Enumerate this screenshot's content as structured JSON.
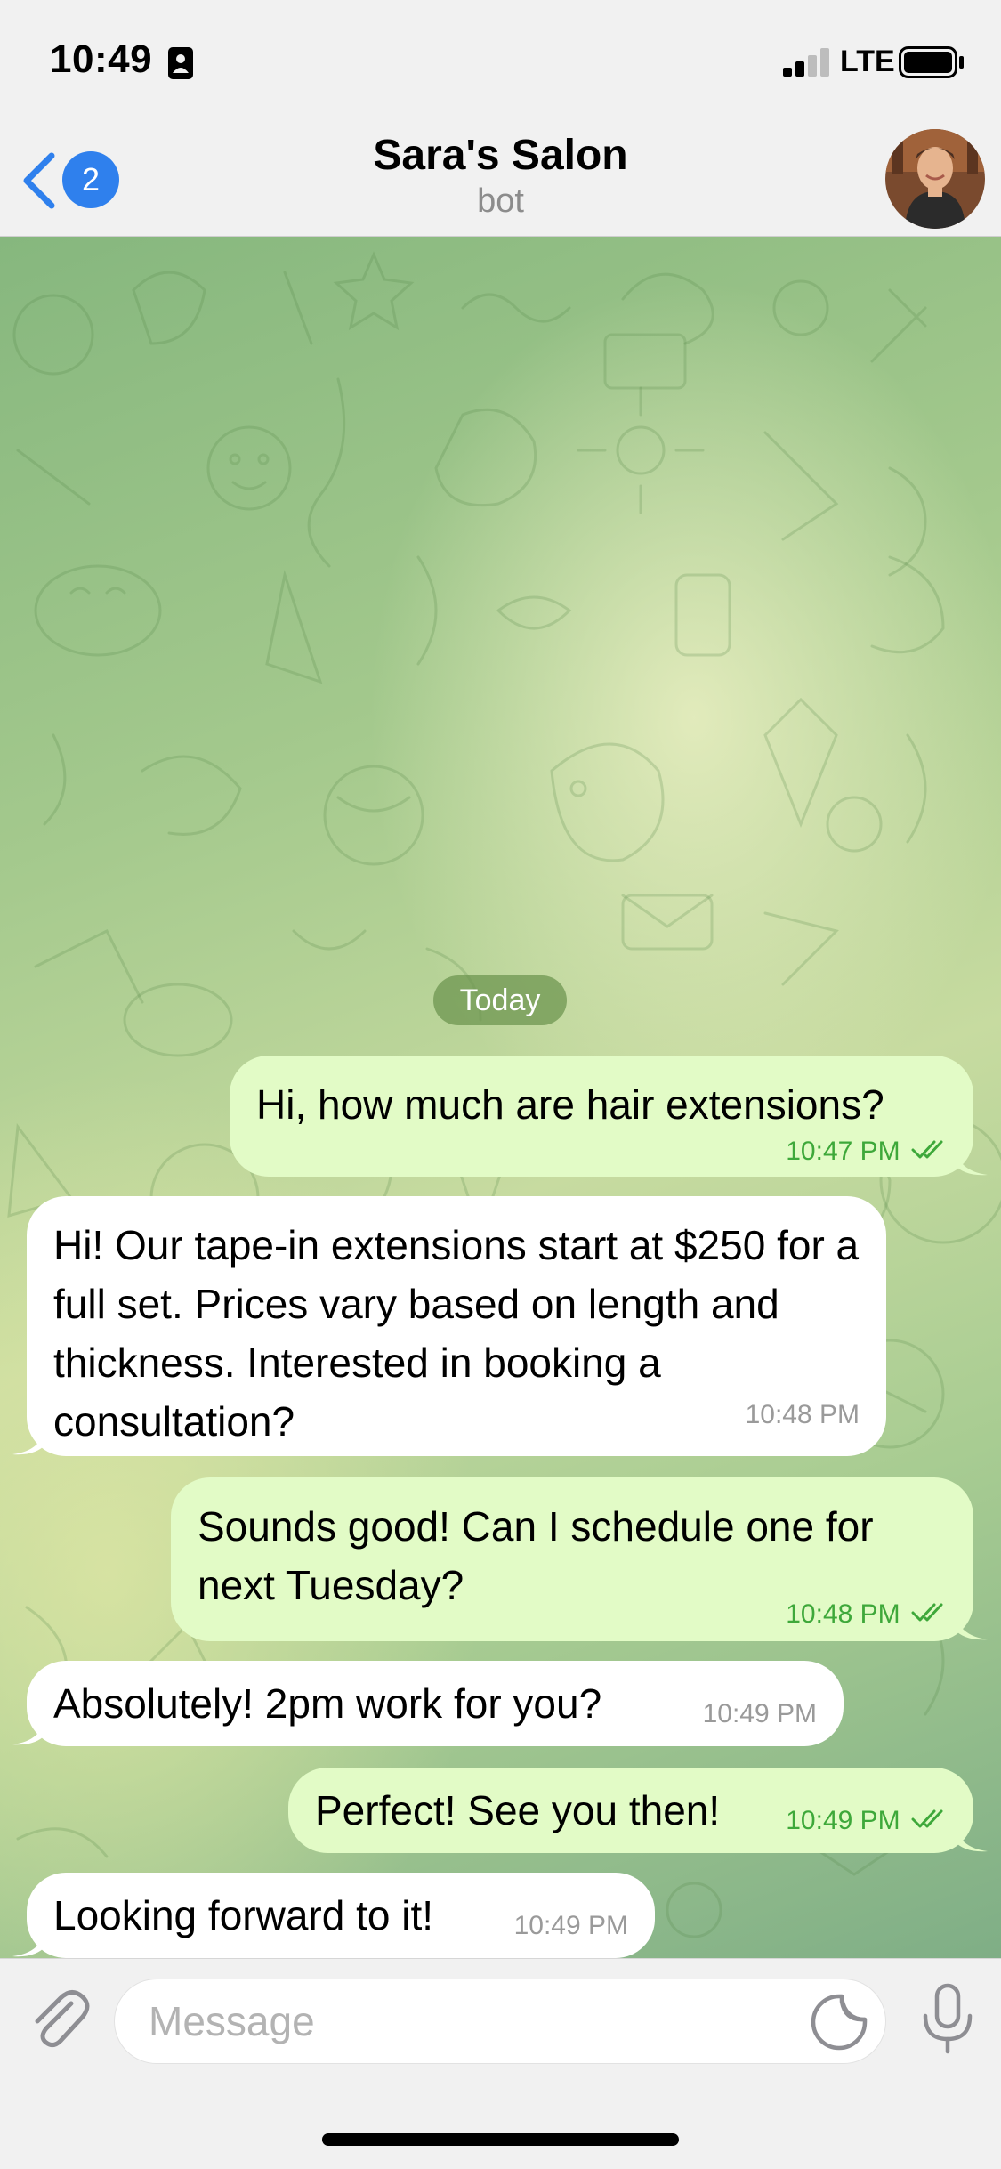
{
  "status_bar": {
    "time": "10:49",
    "network": "LTE"
  },
  "header": {
    "back_badge_count": "2",
    "title": "Sara's Salon",
    "subtitle": "bot",
    "icons": {
      "back": "chevron-left-icon",
      "avatar": "avatar-photo"
    }
  },
  "chat": {
    "date_label": "Today",
    "messages": [
      {
        "direction": "outgoing",
        "text": "Hi, how much are hair extensions?",
        "time": "10:47 PM",
        "read": true
      },
      {
        "direction": "incoming",
        "text": "Hi! Our tape-in extensions start at $250 for a full set. Prices vary based on length and thickness. Interested in booking a consultation?",
        "time": "10:48 PM"
      },
      {
        "direction": "outgoing",
        "text": "Sounds good! Can I schedule one for next Tuesday?",
        "time": "10:48 PM",
        "read": true
      },
      {
        "direction": "incoming",
        "text": "Absolutely! 2pm work for you?",
        "time": "10:49 PM"
      },
      {
        "direction": "outgoing",
        "text": "Perfect! See you then!",
        "time": "10:49 PM",
        "read": true
      },
      {
        "direction": "incoming",
        "text": "Looking forward to it!",
        "time": "10:49 PM"
      }
    ],
    "colors": {
      "outgoing_bubble": "#e2fbc6",
      "incoming_bubble": "#ffffff",
      "outgoing_meta": "#3ea83a",
      "accent": "#2f80ed"
    }
  },
  "input_bar": {
    "placeholder": "Message",
    "value": "",
    "icons": {
      "attach": "paperclip-icon",
      "sticker": "sticker-icon",
      "mic": "microphone-icon"
    }
  }
}
